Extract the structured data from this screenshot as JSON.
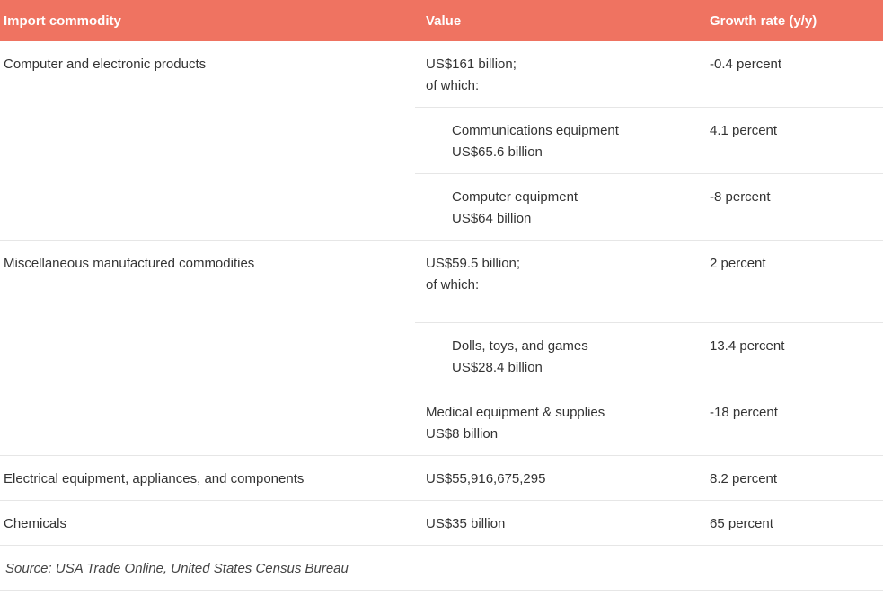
{
  "header": {
    "col1": "Import commodity",
    "col2": "Value",
    "col3": "Growth rate (y/y)"
  },
  "groups": [
    {
      "commodity": "Computer and electronic products",
      "rows": [
        {
          "value_line1": "US$161 billion;",
          "value_line2": "of which:",
          "growth": "-0.4 percent"
        },
        {
          "value_line1": "Communications equipment",
          "value_line2": "US$65.6 billion",
          "growth": "4.1 percent"
        },
        {
          "value_line1": "Computer equipment",
          "value_line2": "US$64 billion",
          "growth": "-8 percent"
        }
      ]
    },
    {
      "commodity": "Miscellaneous manufactured commodities",
      "rows": [
        {
          "value_line1": "US$59.5 billion;",
          "value_line2": "of which:",
          "growth": "2 percent"
        },
        {
          "value_line1": "Dolls, toys, and games",
          "value_line2": "US$28.4 billion",
          "growth": "13.4 percent"
        },
        {
          "value_line1": "Medical equipment & supplies",
          "value_line2": "US$8 billion",
          "growth": "-18 percent"
        }
      ]
    },
    {
      "commodity": "Electrical equipment, appliances, and components",
      "rows": [
        {
          "value_line1": "US$55,916,675,295",
          "growth": "8.2 percent"
        }
      ]
    },
    {
      "commodity": "Chemicals",
      "rows": [
        {
          "value_line1": "US$35 billion",
          "growth": "65 percent"
        }
      ]
    }
  ],
  "source": "Source: USA Trade Online, United States Census Bureau",
  "colors": {
    "header_bg": "#ef7361",
    "header_text": "#ffffff",
    "border": "#e6e6e6"
  }
}
